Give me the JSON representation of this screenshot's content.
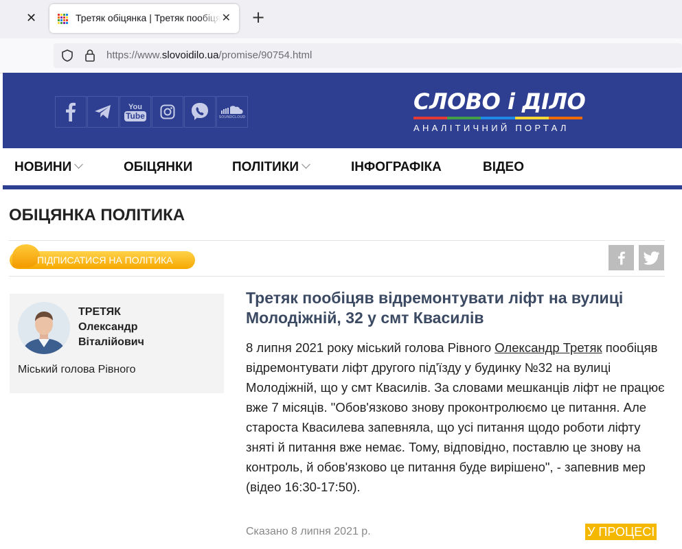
{
  "browser": {
    "tab_title": "Третяк обіцянка | Третяк пообіцяв відремонтувати ліфт",
    "url_prefix": "https://www.",
    "url_domain": "slovoidilo.ua",
    "url_path": "/promise/90754.html"
  },
  "header": {
    "social_icons": [
      "facebook-icon",
      "telegram-icon",
      "youtube-icon",
      "instagram-icon",
      "viber-icon",
      "soundcloud-icon"
    ],
    "youtube_label_top": "You",
    "youtube_label_bottom": "Tube",
    "soundcloud_label": "SOUNDCLOUD",
    "logo_text": "СЛОВО і ДІЛО",
    "logo_subtitle": "АНАЛІТИЧНИЙ ПОРТАЛ",
    "logo_strip_colors": [
      "#e53935",
      "#43a047",
      "#1e88e5",
      "#fdd835",
      "#ef6c00"
    ],
    "brand_color": "#2e3e91"
  },
  "nav": {
    "items": [
      {
        "label": "НОВИНИ",
        "dropdown": true
      },
      {
        "label": "ОБІЦЯНКИ",
        "dropdown": false
      },
      {
        "label": "ПОЛІТИКИ",
        "dropdown": true
      },
      {
        "label": "ІНФОГРАФІКА",
        "dropdown": false
      },
      {
        "label": "ВІДЕО",
        "dropdown": false
      }
    ]
  },
  "page": {
    "title": "ОБІЦЯНКА ПОЛІТИКА",
    "subscribe_label": "ПІДПИСАТИСЯ НА ПОЛІТИКА"
  },
  "politician": {
    "name_line1": "ТРЕТЯК",
    "name_line2": "Олександр",
    "name_line3": "Віталійович",
    "role": "Міський голова Рівного"
  },
  "article": {
    "headline": "Третяк пообіцяв відремонтувати ліфт на вулиці Молодіжній, 32 у смт Квасилів",
    "body_before_link": "8 липня 2021 року міський голова Рівного ",
    "body_link": "Олександр Третяк",
    "body_after_link": " пообіцяв відремонтувати ліфт другого під'їзду у будинку №32 на вулиці Молодіжній, що у смт Квасилів. За словами мешканців ліфт не працює вже 7 місяців. \"Обов'язково знову проконтролюємо це питання. Але староста Квасилева запевняла, що усі питання щодо роботи ліфту зняті й питання вже немає. Тому, відповідно, поставлю це знову на контроль, й обов'язково це питання буде вирішено\", - запевнив мер (відео 16:30-17:50).",
    "said_date": "Сказано 8 липня 2021 р.",
    "status": "У ПРОЦЕСІ",
    "status_color": "#f5b800"
  }
}
